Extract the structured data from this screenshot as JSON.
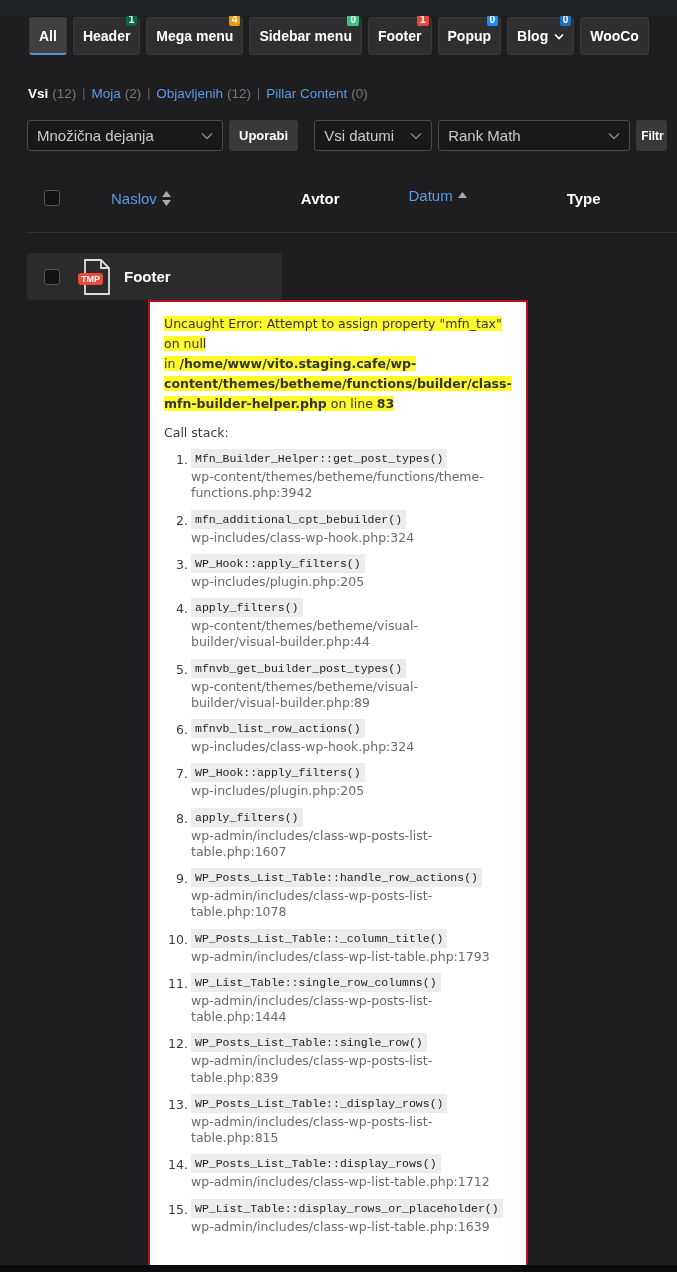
{
  "tabs": [
    {
      "label": "All",
      "selected": true,
      "dropdown": false
    },
    {
      "label": "Header",
      "selected": false,
      "dropdown": false,
      "badge": "1",
      "color": "#0e6647"
    },
    {
      "label": "Mega menu",
      "selected": false,
      "dropdown": false,
      "badge": "4",
      "color": "#f0980f"
    },
    {
      "label": "Sidebar menu",
      "selected": false,
      "dropdown": false,
      "badge": "0",
      "color": "#3cc47f"
    },
    {
      "label": "Footer",
      "selected": false,
      "dropdown": false,
      "badge": "1",
      "color": "#e5483b"
    },
    {
      "label": "Popup",
      "selected": false,
      "dropdown": false,
      "badge": "0",
      "color": "#1c8dff"
    },
    {
      "label": "Blog",
      "selected": false,
      "dropdown": true,
      "badge": "0",
      "color": "#2270b8"
    },
    {
      "label": "WooCo",
      "selected": false,
      "dropdown": false
    }
  ],
  "views": [
    {
      "label": "Vsi",
      "count": "(12)",
      "selected": true
    },
    {
      "separator": "|",
      "label": "Moja",
      "count": "(2)",
      "selected": false
    },
    {
      "separator": "|",
      "label": "Objavljenih",
      "count": "(12)",
      "selected": false
    },
    {
      "separator": "|",
      "label": "Pillar Content",
      "count": "(0)",
      "selected": false
    }
  ],
  "toolbar": {
    "bulk_actions": "Množična dejanja",
    "apply_button": "Uporabi",
    "date_filter": "Vsi datumi",
    "seo_filter": "Rank Math",
    "filter_button": "Filtr"
  },
  "table": {
    "select_all_checked": false,
    "columns": [
      {
        "label": "Naslov",
        "kind": "sortable"
      },
      {
        "label": "Avtor",
        "kind": "plain"
      },
      {
        "label": "Datum",
        "kind": "sorted"
      },
      {
        "label": "Type",
        "kind": "plain"
      }
    ],
    "rows": [
      {
        "title": "Footer",
        "icon_label": "TMP",
        "checked": false
      }
    ]
  },
  "error": {
    "message": "Uncaught Error: Attempt to assign property \"mfn_tax\" on null",
    "location": "in **/home/www/vito.staging.cafe/wp-content/themes/betheme/functions/builder/class-mfn-builder-helper.php** on line **83**",
    "call_stack_label": "Call stack:",
    "stack": [
      {
        "number": "1.",
        "function": "Mfn_Builder_Helper::get_post_types()",
        "file": "wp-content/themes/betheme/functions/theme-functions.php:3942"
      },
      {
        "number": "2.",
        "function": "mfn_additional_cpt_bebuilder()",
        "file": "wp-includes/class-wp-hook.php:324"
      },
      {
        "number": "3.",
        "function": "WP_Hook::apply_filters()",
        "file": "wp-includes/plugin.php:205"
      },
      {
        "number": "4.",
        "function": "apply_filters()",
        "file": "wp-content/themes/betheme/visual-builder/visual-builder.php:44"
      },
      {
        "number": "5.",
        "function": "mfnvb_get_builder_post_types()",
        "file": "wp-content/themes/betheme/visual-builder/visual-builder.php:89"
      },
      {
        "number": "6.",
        "function": "mfnvb_list_row_actions()",
        "file": "wp-includes/class-wp-hook.php:324"
      },
      {
        "number": "7.",
        "function": "WP_Hook::apply_filters()",
        "file": "wp-includes/plugin.php:205"
      },
      {
        "number": "8.",
        "function": "apply_filters()",
        "file": "wp-admin/includes/class-wp-posts-list-table.php:1607"
      },
      {
        "number": "9.",
        "function": "WP_Posts_List_Table::handle_row_actions()",
        "file": "wp-admin/includes/class-wp-posts-list-table.php:1078"
      },
      {
        "number": "10.",
        "function": "WP_Posts_List_Table::_column_title()",
        "file": "wp-admin/includes/class-wp-list-table.php:1793"
      },
      {
        "number": "11.",
        "function": "WP_List_Table::single_row_columns()",
        "file": "wp-admin/includes/class-wp-posts-list-table.php:1444"
      },
      {
        "number": "12.",
        "function": "WP_Posts_List_Table::single_row()",
        "file": "wp-admin/includes/class-wp-posts-list-table.php:839"
      },
      {
        "number": "13.",
        "function": "WP_Posts_List_Table::_display_rows()",
        "file": "wp-admin/includes/class-wp-posts-list-table.php:815"
      },
      {
        "number": "14.",
        "function": "WP_Posts_List_Table::display_rows()",
        "file": "wp-admin/includes/class-wp-list-table.php:1712"
      },
      {
        "number": "15.",
        "function": "WP_List_Table::display_rows_or_placeholder()",
        "file": "wp-admin/includes/class-wp-list-table.php:1639"
      }
    ]
  }
}
